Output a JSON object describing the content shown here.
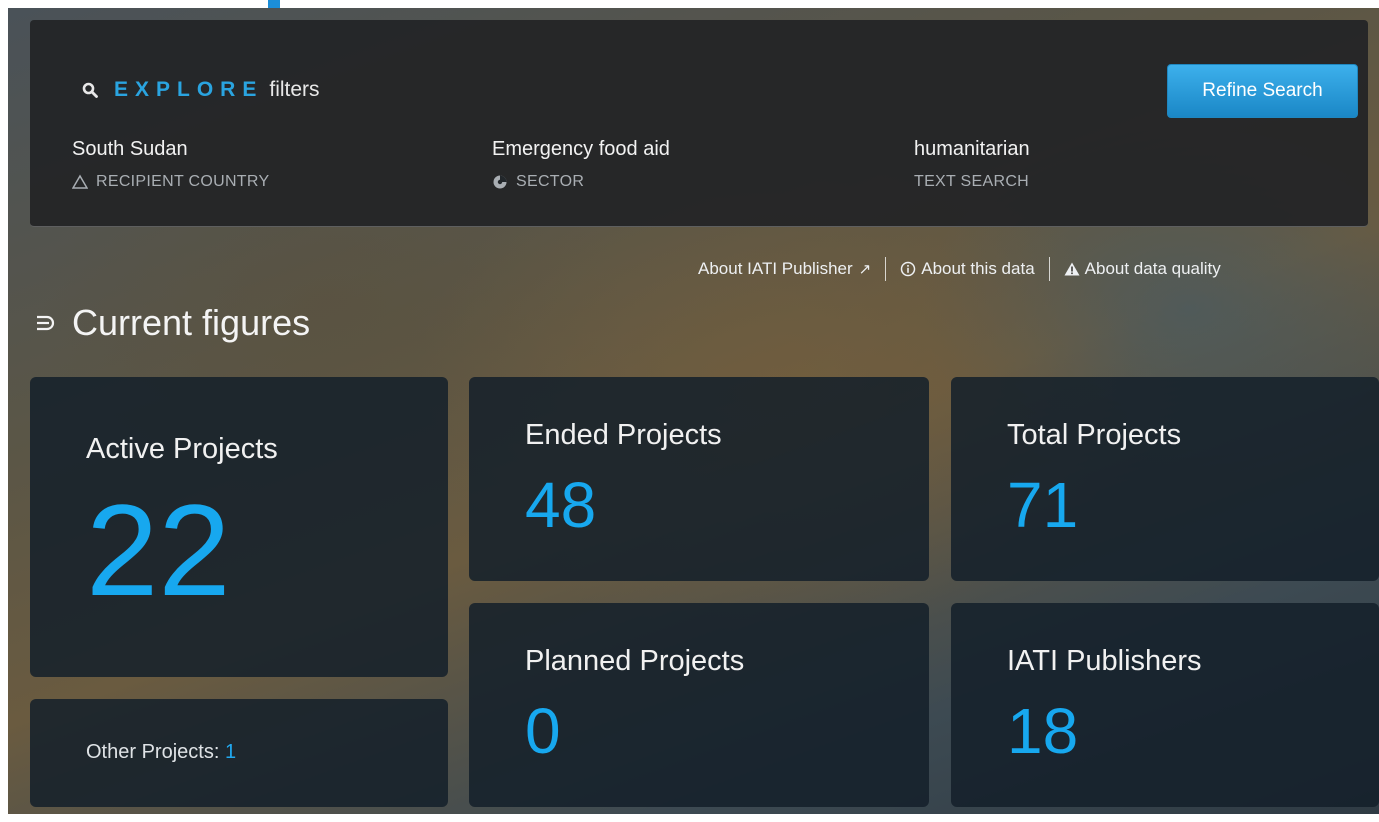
{
  "explore": {
    "accent": "EXPLORE",
    "rest": "filters",
    "refine_button": "Refine Search",
    "filters": [
      {
        "value": "South Sudan",
        "label": "RECIPIENT COUNTRY",
        "icon": "triangle-icon"
      },
      {
        "value": "Emergency food aid",
        "label": "SECTOR",
        "icon": "pie-chart-icon"
      },
      {
        "value": "humanitarian",
        "label": "TEXT SEARCH",
        "icon": ""
      }
    ]
  },
  "links": {
    "publisher": "About IATI Publisher",
    "publisher_arrow": "↗",
    "about_data": "About this data",
    "data_quality": "About data quality"
  },
  "section": {
    "title": "Current figures"
  },
  "figures": {
    "active": {
      "label": "Active Projects",
      "value": "22"
    },
    "ended": {
      "label": "Ended Projects",
      "value": "48"
    },
    "total": {
      "label": "Total Projects",
      "value": "71"
    },
    "planned": {
      "label": "Planned Projects",
      "value": "0"
    },
    "publishers": {
      "label": "IATI Publishers",
      "value": "18"
    },
    "other": {
      "label": "Other Projects:",
      "value": "1"
    }
  },
  "colors": {
    "accent": "#2aa4e0",
    "number": "#17a8ef",
    "button": "#2a9ad8"
  }
}
